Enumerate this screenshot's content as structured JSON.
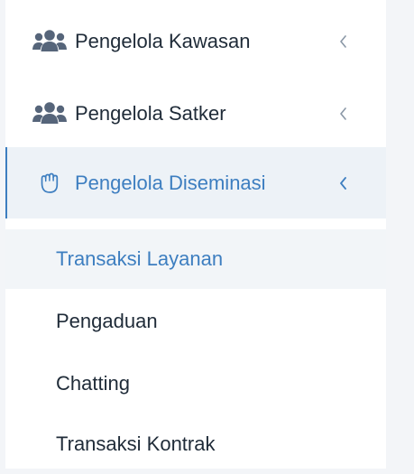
{
  "sidebar": {
    "menu": [
      {
        "label": "Pengelola Kawasan",
        "icon": "users-icon",
        "chevron": "chevron-left-icon"
      },
      {
        "label": "Pengelola Satker",
        "icon": "users-icon",
        "chevron": "chevron-left-icon"
      },
      {
        "label": "Pengelola Diseminasi",
        "icon": "hand-icon",
        "chevron": "chevron-left-icon",
        "active": true
      }
    ],
    "submenu": [
      {
        "label": "Transaksi Layanan",
        "selected": true
      },
      {
        "label": "Pengaduan"
      },
      {
        "label": "Chatting"
      },
      {
        "label": "Transaksi Kontrak"
      }
    ]
  },
  "colors": {
    "accent": "#3d7ec0",
    "text": "#1f2b38",
    "icon_gray": "#56657a",
    "active_bg": "#edf2f7",
    "page_bg": "#f3f5f8"
  }
}
